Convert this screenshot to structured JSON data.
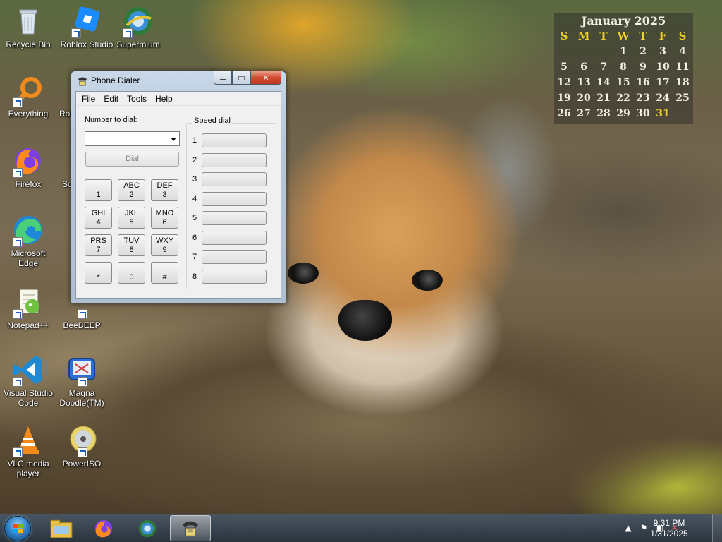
{
  "desktop": {
    "icons": [
      {
        "label": "Recycle Bin",
        "icon": "recycle-bin-icon"
      },
      {
        "label": "Roblox Studio",
        "icon": "roblox-studio-icon"
      },
      {
        "label": "Supermium",
        "icon": "supermium-icon"
      },
      {
        "label": "Everything",
        "icon": "everything-icon"
      },
      {
        "label": "Rol",
        "icon": "roblox-icon"
      },
      {
        "label": "Firefox",
        "icon": "firefox-icon"
      },
      {
        "label": "Sc",
        "icon": "generic-app-icon"
      },
      {
        "label": "Microsoft Edge",
        "icon": "edge-icon"
      },
      {
        "label": "Notepad++",
        "icon": "notepad-plus-plus-icon"
      },
      {
        "label": "BeeBEEP",
        "icon": "beebeep-icon"
      },
      {
        "label": "Visual Studio Code",
        "icon": "vscode-icon"
      },
      {
        "label": "Magna Doodle(TM)",
        "icon": "magna-doodle-icon"
      },
      {
        "label": "VLC media player",
        "icon": "vlc-icon"
      },
      {
        "label": "PowerISO",
        "icon": "poweriso-icon"
      }
    ]
  },
  "calendar": {
    "title": "January 2025",
    "weekdays": [
      "S",
      "M",
      "T",
      "W",
      "T",
      "F",
      "S"
    ],
    "days": [
      "",
      "",
      "",
      "1",
      "2",
      "3",
      "4",
      "5",
      "6",
      "7",
      "8",
      "9",
      "10",
      "11",
      "12",
      "13",
      "14",
      "15",
      "16",
      "17",
      "18",
      "19",
      "20",
      "21",
      "22",
      "23",
      "24",
      "25",
      "26",
      "27",
      "28",
      "29",
      "30",
      "31",
      ""
    ],
    "today": "31",
    "today_color": "#f1d22a"
  },
  "dialer": {
    "title": "Phone Dialer",
    "menu": [
      "File",
      "Edit",
      "Tools",
      "Help"
    ],
    "number_label": "Number to dial:",
    "number_value": "",
    "dial_label": "Dial",
    "speed_dial_label": "Speed dial",
    "keys": [
      {
        "letters": "",
        "digit": "1"
      },
      {
        "letters": "ABC",
        "digit": "2"
      },
      {
        "letters": "DEF",
        "digit": "3"
      },
      {
        "letters": "GHI",
        "digit": "4"
      },
      {
        "letters": "JKL",
        "digit": "5"
      },
      {
        "letters": "MNO",
        "digit": "6"
      },
      {
        "letters": "PRS",
        "digit": "7"
      },
      {
        "letters": "TUV",
        "digit": "8"
      },
      {
        "letters": "WXY",
        "digit": "9"
      },
      {
        "letters": "",
        "digit": "*"
      },
      {
        "letters": "",
        "digit": "0"
      },
      {
        "letters": "",
        "digit": "#"
      }
    ],
    "speed_numbers": [
      "1",
      "2",
      "3",
      "4",
      "5",
      "6",
      "7",
      "8"
    ]
  },
  "taskbar": {
    "time": "9:31 PM",
    "date": "1/31/2025",
    "pinned": [
      "explorer-icon",
      "firefox-icon",
      "supermium-icon",
      "phone-dialer-icon"
    ],
    "active": "phone-dialer-icon"
  }
}
